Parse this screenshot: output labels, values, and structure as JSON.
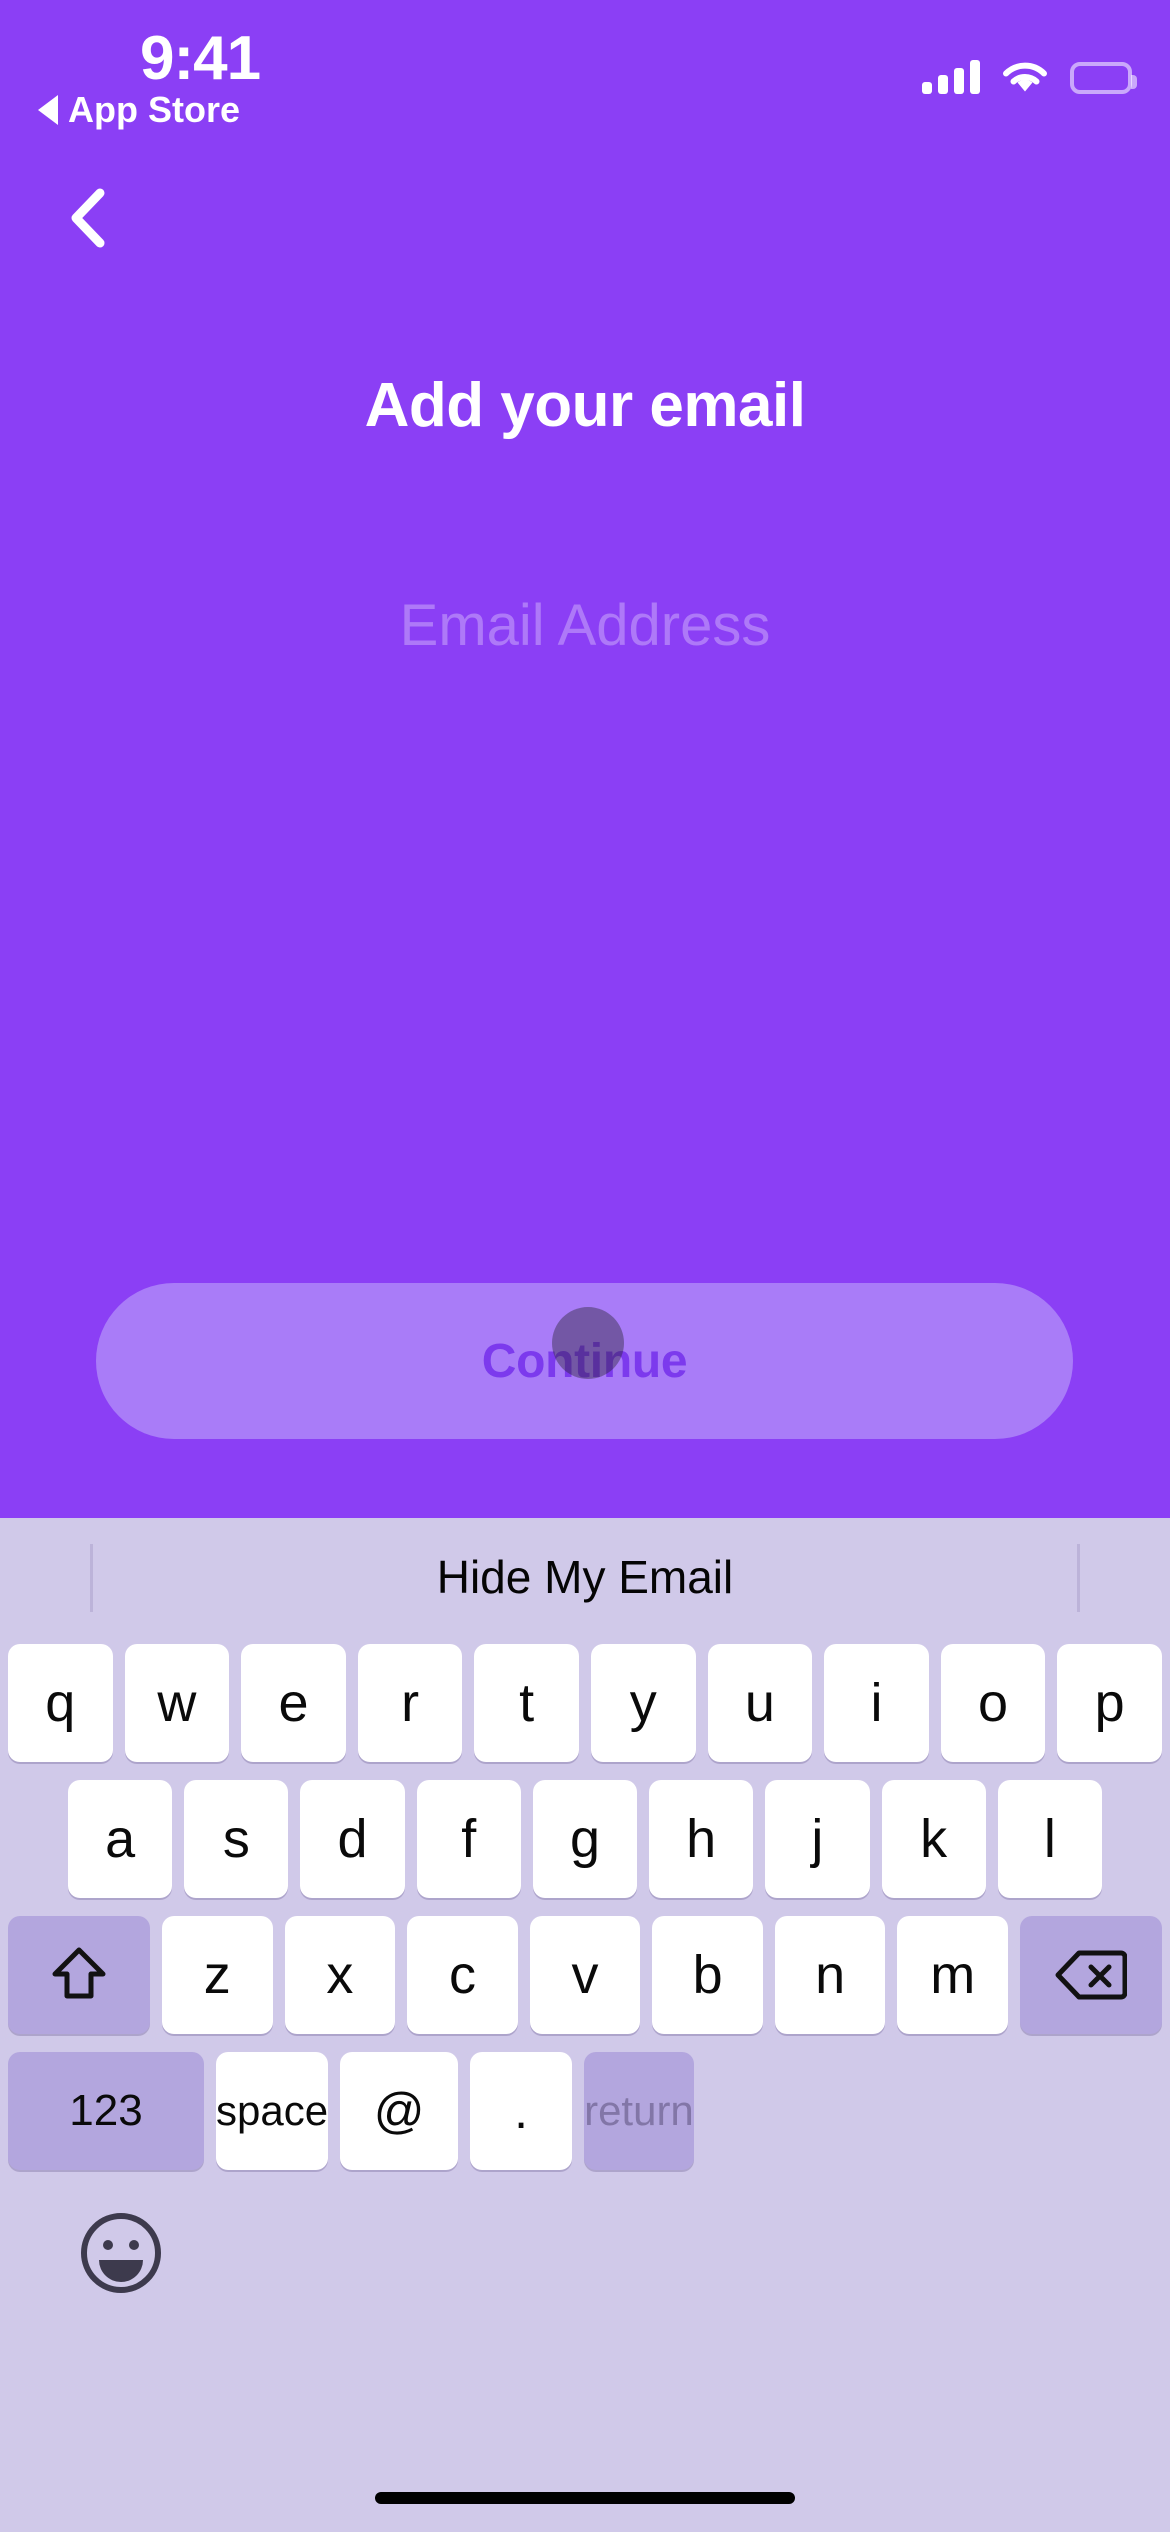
{
  "status_bar": {
    "time": "9:41",
    "back_app_label": "App Store",
    "back_app_icon": "triangle-left-icon",
    "signal_icon": "cellular-signal-icon",
    "wifi_icon": "wifi-icon",
    "battery_icon": "battery-full-icon"
  },
  "nav": {
    "back_icon": "chevron-left-icon"
  },
  "main": {
    "title": "Add your email",
    "email_placeholder": "Email Address",
    "email_value": "",
    "continue_label": "Continue",
    "touch_indicator": "touch-cursor-indicator"
  },
  "colors": {
    "background_purple": "#8b3ff5",
    "button_fill": "#a97cf8",
    "button_text": "#7c3aed",
    "keyboard_bg": "#d0c9e9",
    "key_white": "#ffffff",
    "key_dark": "#b3a6de",
    "return_text": "#6b5f8c"
  },
  "keyboard": {
    "prediction": "Hide My Email",
    "row1": [
      "q",
      "w",
      "e",
      "r",
      "t",
      "y",
      "u",
      "i",
      "o",
      "p"
    ],
    "row2": [
      "a",
      "s",
      "d",
      "f",
      "g",
      "h",
      "j",
      "k",
      "l"
    ],
    "row3": [
      "z",
      "x",
      "c",
      "v",
      "b",
      "n",
      "m"
    ],
    "shift_icon": "shift-arrow-up-icon",
    "backspace_icon": "backspace-delete-icon",
    "numbers_label": "123",
    "space_label": "space",
    "at_label": "@",
    "period_label": ".",
    "return_label": "return",
    "emoji_icon": "emoji-smiley-icon"
  },
  "system": {
    "home_indicator": "home-indicator-bar"
  }
}
